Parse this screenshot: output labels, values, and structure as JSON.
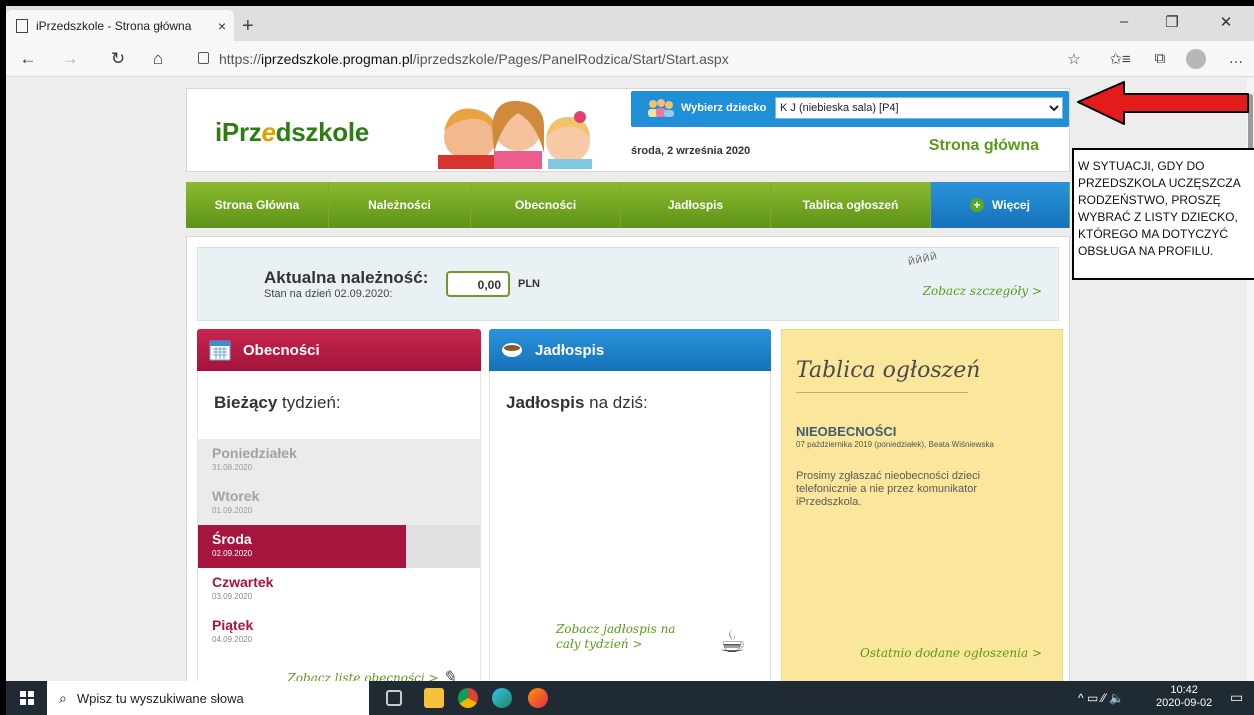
{
  "browser": {
    "tab_title": "iPrzedszkole - Strona główna",
    "tab_close": "×",
    "new_tab": "+",
    "min": "–",
    "max": "❐",
    "close": "✕",
    "back": "←",
    "forward": "→",
    "refresh": "↻",
    "home": "⌂",
    "url_prefix": "https://",
    "url_host": "iprzedszkole.progman.pl",
    "url_path": "/iprzedszkole/Pages/PanelRodzica/Start/Start.aspx",
    "star": "☆",
    "favorites": "✩≡",
    "collections": "⧉",
    "more": "…"
  },
  "header": {
    "logo_part1": "iPrz",
    "logo_e": "e",
    "logo_part2": "dszkole",
    "choose_label": "Wybierz dziecko",
    "child_selected": "K      J        (niebieska sala) [P4]",
    "date": "środa, 2 września 2020",
    "page_title": "Strona główna"
  },
  "menu": {
    "items": [
      "Strona Główna",
      "Należności",
      "Obecności",
      "Jadłospis",
      "Tablica ogłoszeń"
    ],
    "more_label": "Więcej",
    "more_plus": "+"
  },
  "due": {
    "title": "Aktualna należność:",
    "subtitle": "Stan na dzień 02.09.2020:",
    "amount": "0,00",
    "currency": "PLN",
    "details_link": "Zobacz szczegóły >",
    "spiral": "ЙЙЙЙ"
  },
  "attendance": {
    "title": "Obecności",
    "heading_bold": "Bieżący",
    "heading_rest": " tydzień:",
    "days": [
      {
        "name": "Poniedziałek",
        "date": "31.08.2020"
      },
      {
        "name": "Wtorek",
        "date": "01.09.2020"
      },
      {
        "name": "Środa",
        "date": "02.09.2020"
      },
      {
        "name": "Czwartek",
        "date": "03.09.2020"
      },
      {
        "name": "Piątek",
        "date": "04.09.2020"
      }
    ],
    "link": "Zobacz listę obecności >",
    "pen": "✎"
  },
  "menu_card": {
    "title": "Jadłospis",
    "heading_bold": "Jadłospis",
    "heading_rest": " na dziś:",
    "link_line1": "Zobacz jadłospis na",
    "link_line2": "cały tydzień >",
    "cup": "☕"
  },
  "board": {
    "title": "Tablica ogłoszeń",
    "ann_title": "NIEOBECNOŚCI",
    "ann_meta": "07 października 2019 (poniedziałek), Beata Wiśniewska",
    "ann_body": "Prosimy zgłaszać nieobecności dzieci telefonicznie a nie przez komunikator iPrzedszkola.",
    "recent_link": "Ostatnio dodane ogłoszenia >"
  },
  "note": {
    "text": "W SYTUACJI, GDY DO PRZEDSZKOLA UCZĘSZCZA RODZEŃSTWO, PROSZĘ WYBRAĆ Z LISTY DZIECKO, KTÓREGO MA DOTYCZYĆ OBSŁUGA NA PROFILU."
  },
  "taskbar": {
    "search_placeholder": "Wpisz tu wyszukiwane słowa",
    "search_icon": "⌕",
    "time": "10:42",
    "date": "2020-09-02",
    "tray": "^  ▭  ⁄⁄  🔈"
  },
  "colors": {
    "menu_green": "#6fa21f",
    "accent_blue": "#1f8fd8",
    "attendance_red": "#a5153d",
    "board_yellow": "#fbe79c",
    "arrow_red": "#e31b1b"
  }
}
